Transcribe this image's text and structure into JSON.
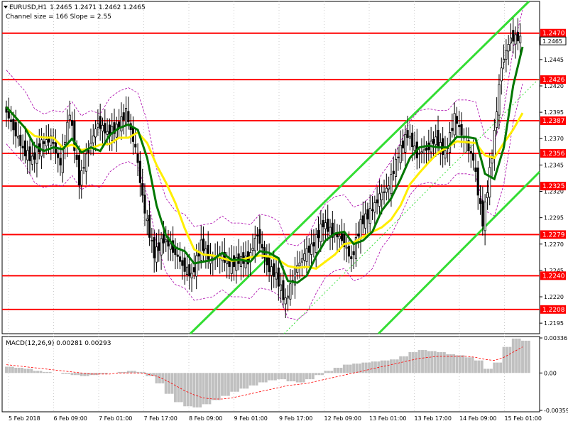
{
  "chart_data": {
    "type": "candlestick",
    "symbol": "EURUSD,H1",
    "ohlc": "1.2465 1.2471 1.2462 1.2465",
    "channel_text": "Channel size = 166 Slope = 2.55",
    "y_range": [
      1.2185,
      1.2488
    ],
    "y_ticks": [
      "1.2445",
      "1.2420",
      "1.2395",
      "1.2370",
      "1.2345",
      "1.2320",
      "1.2295",
      "1.2270",
      "1.2245",
      "1.2220",
      "1.2195"
    ],
    "levels": [
      {
        "label": "1.2470",
        "value": 1.247
      },
      {
        "label": "1.2426",
        "value": 1.2426
      },
      {
        "label": "1.2387",
        "value": 1.2387
      },
      {
        "label": "1.2356",
        "value": 1.2356
      },
      {
        "label": "1.2325",
        "value": 1.2325
      },
      {
        "label": "1.2279",
        "value": 1.2279
      },
      {
        "label": "1.2240",
        "value": 1.224
      },
      {
        "label": "1.2208",
        "value": 1.2208
      }
    ],
    "current_price_label": "1.2465",
    "x_labels": [
      "5 Feb 2018",
      "6 Feb 09:00",
      "7 Feb 01:00",
      "7 Feb 17:00",
      "8 Feb 09:00",
      "9 Feb 01:00",
      "9 Feb 17:00",
      "12 Feb 09:00",
      "13 Feb 01:00",
      "13 Feb 17:00",
      "14 Feb 09:00",
      "15 Feb 01:00"
    ],
    "close_path": [
      1.24,
      1.238,
      1.236,
      1.235,
      1.2365,
      1.237,
      1.2345,
      1.2395,
      1.233,
      1.236,
      1.2385,
      1.2375,
      1.238,
      1.2395,
      1.236,
      1.23,
      1.226,
      1.2275,
      1.2265,
      1.225,
      1.224,
      1.227,
      1.2255,
      1.226,
      1.225,
      1.2255,
      1.2255,
      1.228,
      1.225,
      1.224,
      1.2215,
      1.2245,
      1.226,
      1.227,
      1.229,
      1.228,
      1.2275,
      1.2255,
      1.229,
      1.23,
      1.2315,
      1.2325,
      1.2355,
      1.2375,
      1.2355,
      1.236,
      1.237,
      1.2355,
      1.239,
      1.237,
      1.235,
      1.229,
      1.2355,
      1.244,
      1.2466,
      1.2465
    ],
    "macd": {
      "label": "MACD(12,26,9) 0.00281 0.00293",
      "ticks": [
        "0.00336",
        "0.00",
        "-0.00359"
      ],
      "range": [
        -0.00359,
        0.00336
      ],
      "histogram": [
        0.0006,
        0.0005,
        0.0004,
        0.0002,
        0.0001,
        0.0,
        -0.0001,
        -0.0002,
        -0.0003,
        -0.0002,
        -0.0001,
        0.0,
        0.0001,
        0.0002,
        0.0001,
        -0.0003,
        -0.001,
        -0.002,
        -0.0028,
        -0.0032,
        -0.0033,
        -0.003,
        -0.0026,
        -0.0022,
        -0.0018,
        -0.0015,
        -0.0012,
        -0.0009,
        -0.0007,
        -0.0006,
        -0.0008,
        -0.0009,
        -0.0006,
        -0.0002,
        0.0002,
        0.0005,
        0.0008,
        0.0009,
        0.001,
        0.0011,
        0.0012,
        0.0013,
        0.0016,
        0.002,
        0.0022,
        0.0021,
        0.002,
        0.0018,
        0.0017,
        0.0015,
        0.0012,
        0.0004,
        0.001,
        0.0025,
        0.0033,
        0.0031
      ],
      "signal": [
        0.0008,
        0.0007,
        0.0006,
        0.0005,
        0.0004,
        0.0003,
        0.0002,
        0.0001,
        0.0,
        -0.0001,
        -0.0001,
        -0.0001,
        0.0,
        0.0,
        0.0,
        -0.0001,
        -0.0003,
        -0.0007,
        -0.0012,
        -0.0017,
        -0.0021,
        -0.0024,
        -0.0025,
        -0.0025,
        -0.0024,
        -0.0022,
        -0.002,
        -0.0018,
        -0.0016,
        -0.0014,
        -0.0012,
        -0.0011,
        -0.001,
        -0.0008,
        -0.0006,
        -0.0004,
        -0.0002,
        0.0,
        0.0002,
        0.0004,
        0.0006,
        0.0008,
        0.001,
        0.0012,
        0.0014,
        0.0015,
        0.0016,
        0.0016,
        0.0016,
        0.0016,
        0.0015,
        0.0013,
        0.0012,
        0.0015,
        0.002,
        0.0025
      ]
    }
  },
  "colors": {
    "level": "#ff0000",
    "channel": "#33dd33",
    "ma_yellow": "#ffee00",
    "ma_green": "#007700",
    "envelope": "#aa00aa",
    "hist": "#c0c0c0",
    "signal": "#ff0000",
    "tag_bg": "#ff0000",
    "current_bg": "#ffffff"
  }
}
